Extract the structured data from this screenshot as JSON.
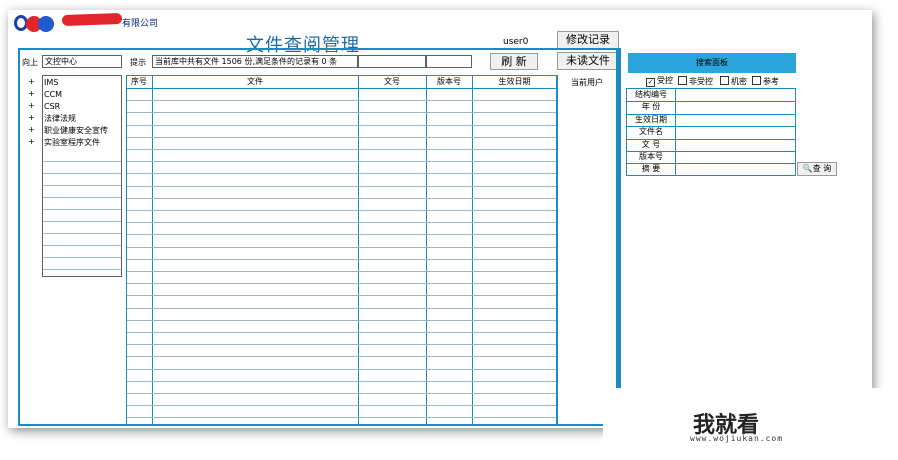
{
  "header": {
    "company_suffix": "有限公司",
    "title": "文件查阅管理",
    "user": "user0"
  },
  "buttons": {
    "modify_log": "修改记录",
    "unread": "未读文件",
    "refresh": "刷 新",
    "query": "查 询"
  },
  "toolbar": {
    "up_label": "向上",
    "location": "文控中心",
    "hint_label": "提示",
    "hint_text": "当前库中共有文件 1506 份,满足条件的记录有 0 条",
    "current_user_label": "当前用户"
  },
  "tree": {
    "items": [
      {
        "expander": "+",
        "label": "IMS"
      },
      {
        "expander": "+",
        "label": "CCM"
      },
      {
        "expander": "+",
        "label": "CSR"
      },
      {
        "expander": "+",
        "label": "法律法规"
      },
      {
        "expander": "+",
        "label": "职业健康安全宣传"
      },
      {
        "expander": "+",
        "label": "实验室程序文件"
      }
    ]
  },
  "table": {
    "columns": [
      "序号",
      "文件",
      "文号",
      "版本号",
      "生效日期"
    ],
    "rows": []
  },
  "search_panel": {
    "title": "搜索面板",
    "filters": [
      {
        "label": "受控",
        "checked": true
      },
      {
        "label": "非受控",
        "checked": false
      },
      {
        "label": "机密",
        "checked": false
      },
      {
        "label": "参考",
        "checked": false
      }
    ],
    "fields": [
      "结构编号",
      "年  份",
      "生效日期",
      "文件名",
      "文  号",
      "版本号",
      "摘  要"
    ]
  },
  "watermark": {
    "brand": "我就看",
    "url": "www.wojiukan.com"
  },
  "colors": {
    "accent": "#1a8cc0",
    "panel_head": "#2aa6dd",
    "title": "#1a6aa8"
  }
}
